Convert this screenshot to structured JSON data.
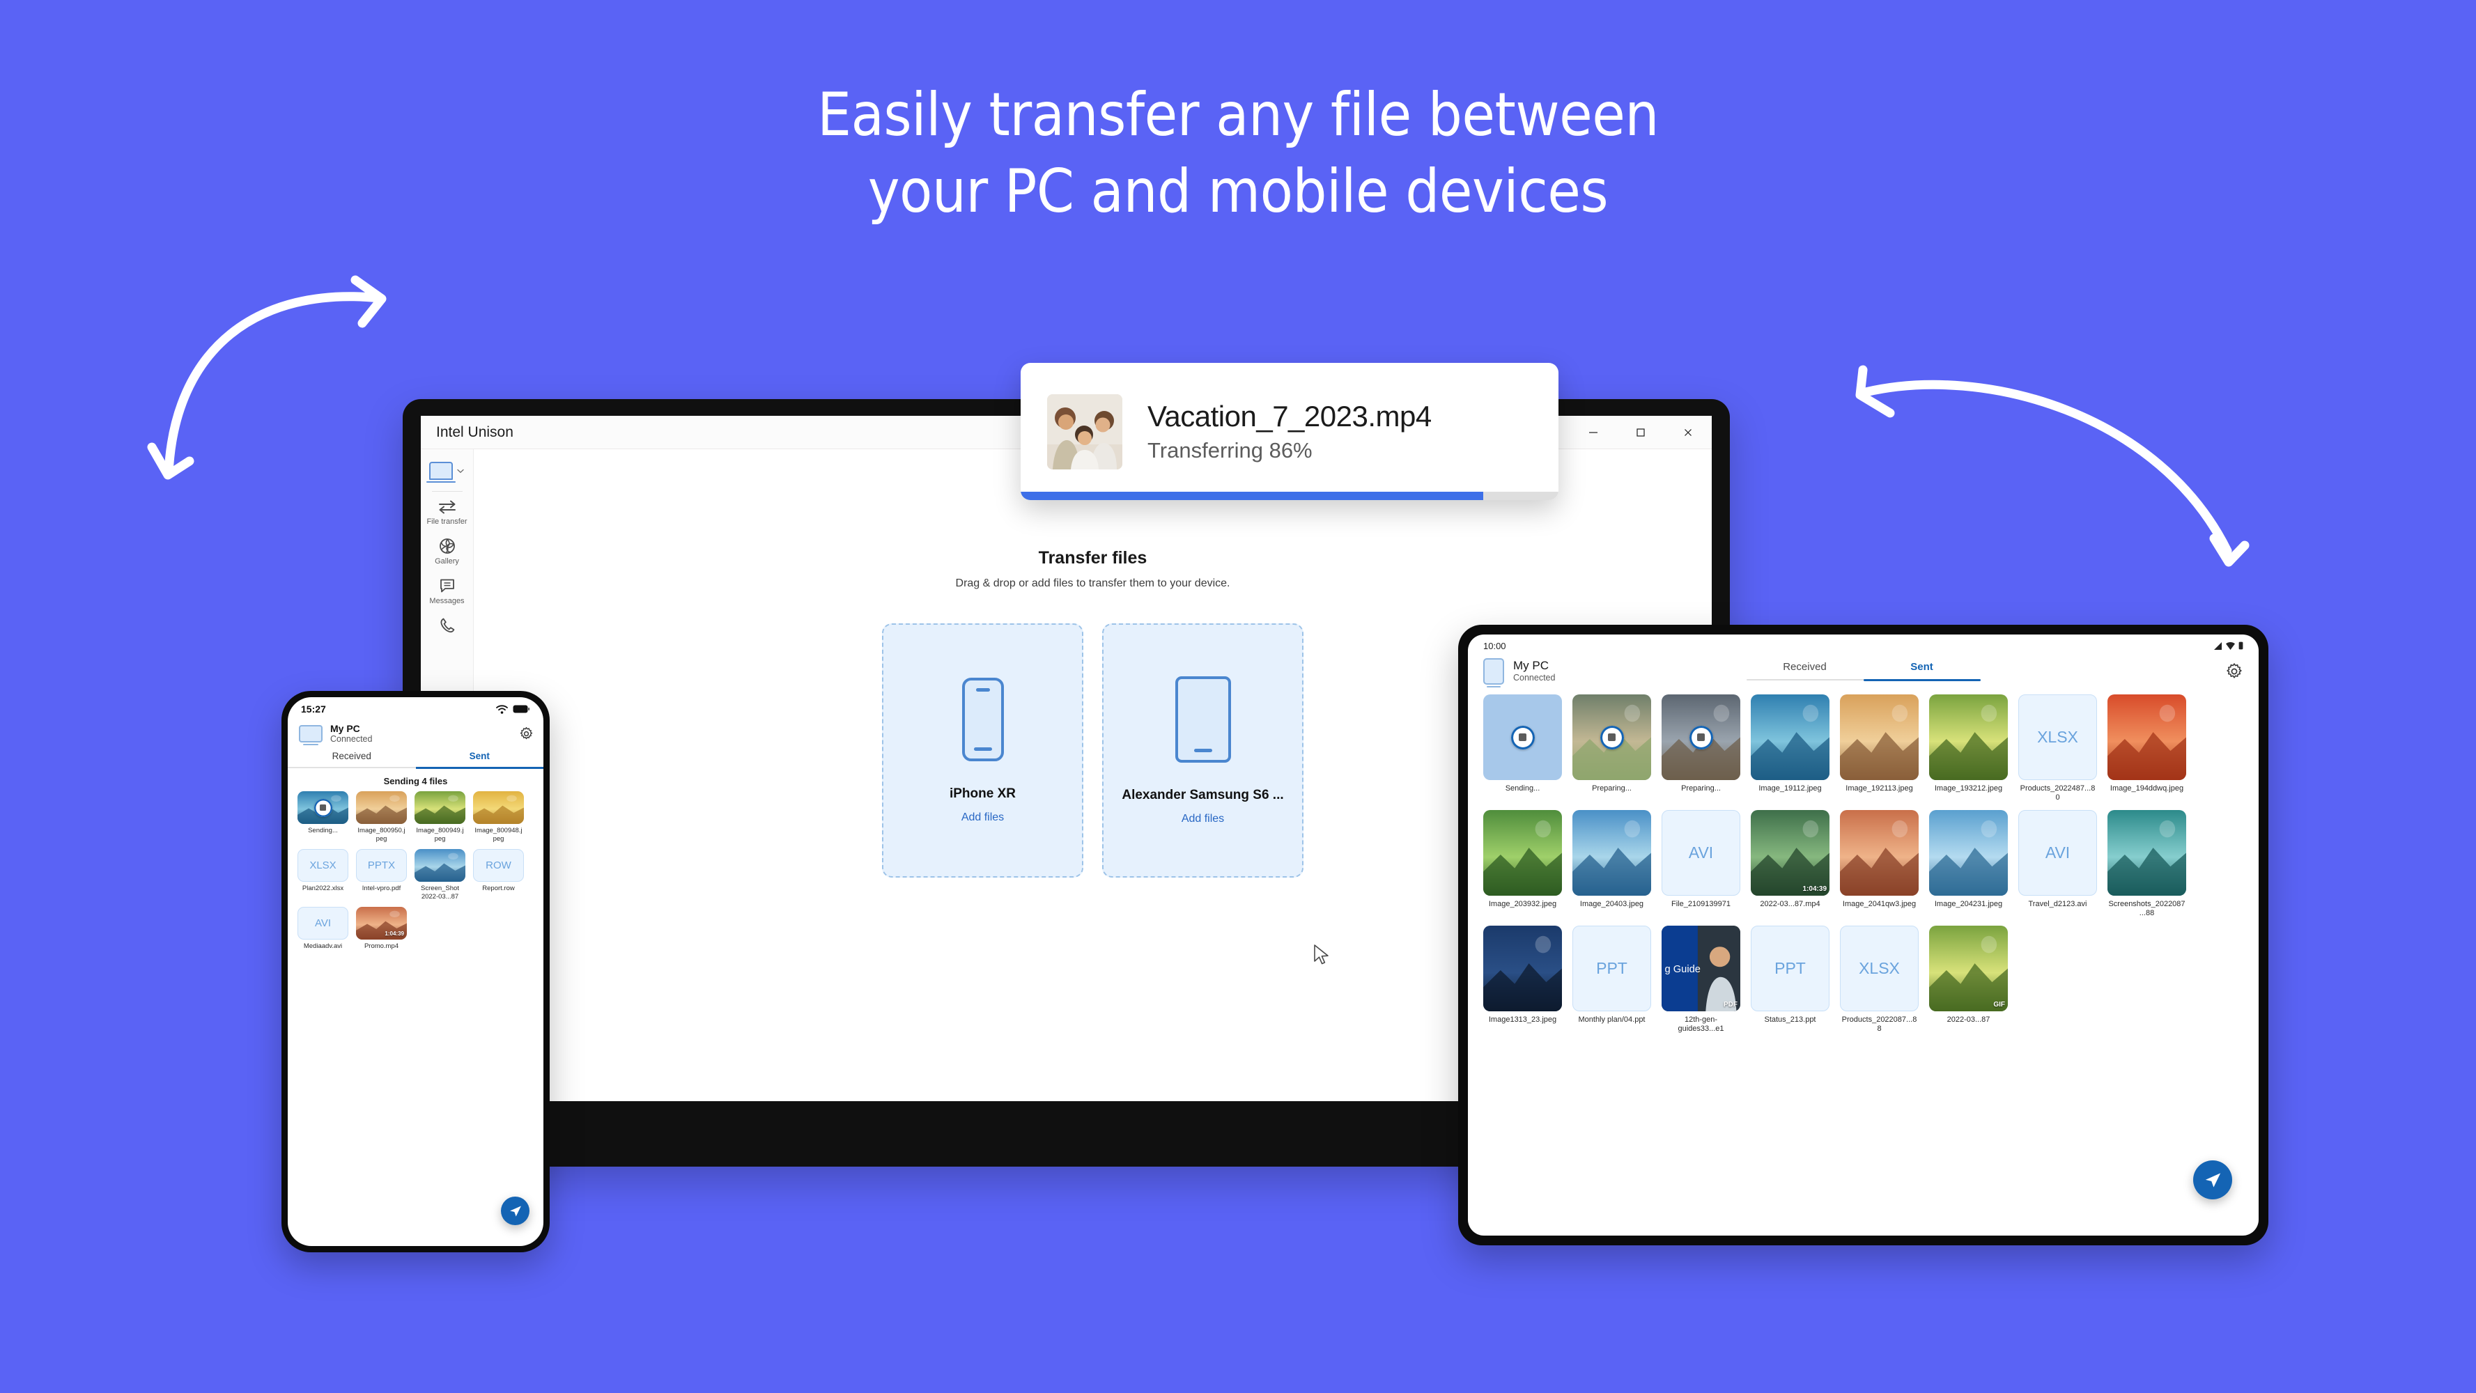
{
  "theme": {
    "background": "#5a63f5",
    "accent_blue": "#1464b4",
    "progress_blue": "#3d6fe8",
    "doc_tile_bg": "#eaf4fe",
    "doc_tile_text": "#6aa3dd"
  },
  "headline": {
    "line1": "Easily transfer any file between",
    "line2": "your PC and mobile devices"
  },
  "toast": {
    "filename": "Vacation_7_2023.mp4",
    "status": "Transferring 86%",
    "progress_percent": 86
  },
  "desktop": {
    "window_title": "Intel Unison",
    "window_controls": [
      {
        "name": "minimize",
        "glyph": "–"
      },
      {
        "name": "maximize",
        "glyph": "□"
      },
      {
        "name": "close",
        "glyph": "✕"
      }
    ],
    "sidebar": {
      "device_selector_icon": "laptop-icon",
      "items": [
        {
          "label": "File transfer",
          "icon": "transfer-arrows-icon"
        },
        {
          "label": "Gallery",
          "icon": "aperture-icon"
        },
        {
          "label": "Messages",
          "icon": "chat-bubble-icon"
        },
        {
          "label": "",
          "icon": "phone-call-icon"
        }
      ]
    },
    "main": {
      "title": "Transfer files",
      "subtitle": "Drag & drop or add files to transfer them to your device.",
      "dropzones": [
        {
          "device": "iPhone XR",
          "action": "Add files",
          "icon": "phone-outline-icon"
        },
        {
          "device": "Alexander Samsung S6 ...",
          "action": "Add files",
          "icon": "tablet-outline-icon"
        }
      ]
    }
  },
  "phone": {
    "status_time": "15:27",
    "status_icons": [
      "wifi-icon",
      "battery-icon"
    ],
    "pc_name": "My PC",
    "pc_status": "Connected",
    "settings_icon": "gear-icon",
    "tabs": [
      {
        "label": "Received",
        "active": false
      },
      {
        "label": "Sent",
        "active": true
      }
    ],
    "sending_label": "Sending 4 files",
    "send_button_icon": "send-paper-plane-icon",
    "files": [
      {
        "name": "Sending...",
        "kind": "image",
        "state": "sending"
      },
      {
        "name": "Image_800950.jpeg",
        "kind": "image"
      },
      {
        "name": "Image_800949.jpeg",
        "kind": "image"
      },
      {
        "name": "Image_800948.jpeg",
        "kind": "image"
      },
      {
        "name": "Plan2022.xlsx",
        "kind": "doc",
        "ext": "XLSX"
      },
      {
        "name": "Intel-vpro.pdf",
        "kind": "doc",
        "ext": "PPTX"
      },
      {
        "name": "Screen_Shot 2022-03...87",
        "kind": "image"
      },
      {
        "name": "Report.row",
        "kind": "doc",
        "ext": "ROW"
      },
      {
        "name": "Mediaadv.avi",
        "kind": "doc",
        "ext": "AVI"
      },
      {
        "name": "Promo.mp4",
        "kind": "video",
        "duration": "1:04:39"
      }
    ]
  },
  "tablet": {
    "status_time": "10:00",
    "status_icons": [
      "signal-icon",
      "wifi-icon",
      "battery-icon"
    ],
    "pc_name": "My PC",
    "pc_status": "Connected",
    "settings_icon": "gear-icon",
    "tabs": [
      {
        "label": "Received",
        "active": false
      },
      {
        "label": "Sent",
        "active": true
      }
    ],
    "send_button_icon": "send-paper-plane-icon",
    "files": [
      {
        "name": "Sending...",
        "kind": "blank",
        "state": "sending"
      },
      {
        "name": "Preparing...",
        "kind": "image",
        "state": "sending"
      },
      {
        "name": "Preparing...",
        "kind": "image",
        "state": "sending"
      },
      {
        "name": "Image_19112.jpeg",
        "kind": "image"
      },
      {
        "name": "Image_192113.jpeg",
        "kind": "image"
      },
      {
        "name": "Image_193212.jpeg",
        "kind": "image"
      },
      {
        "name": "Products_2022487...80",
        "kind": "doc",
        "ext": "XLSX"
      },
      {
        "name": "Image_194ddwq.jpeg",
        "kind": "image"
      },
      {
        "name": "Image_203932.jpeg",
        "kind": "image"
      },
      {
        "name": "Image_20403.jpeg",
        "kind": "image"
      },
      {
        "name": "File_2109139971",
        "kind": "doc",
        "ext": "AVI"
      },
      {
        "name": "2022-03...87.mp4",
        "kind": "video",
        "duration": "1:04:39"
      },
      {
        "name": "Image_2041qw3.jpeg",
        "kind": "image"
      },
      {
        "name": "Image_204231.jpeg",
        "kind": "image"
      },
      {
        "name": "Travel_d2123.avi",
        "kind": "doc",
        "ext": "AVI"
      },
      {
        "name": "Screenshots_2022087...88",
        "kind": "image"
      },
      {
        "name": "Image1313_23.jpeg",
        "kind": "image"
      },
      {
        "name": "Monthly plan/04.ppt",
        "kind": "doc",
        "ext": "PPT"
      },
      {
        "name": "12th-gen-guides33...e1",
        "kind": "pdf",
        "badge": "PDF"
      },
      {
        "name": "Status_213.ppt",
        "kind": "doc",
        "ext": "PPT"
      },
      {
        "name": "Products_2022087...88",
        "kind": "doc",
        "ext": "XLSX"
      },
      {
        "name": "2022-03...87",
        "kind": "image",
        "badge": "GIF"
      }
    ]
  }
}
